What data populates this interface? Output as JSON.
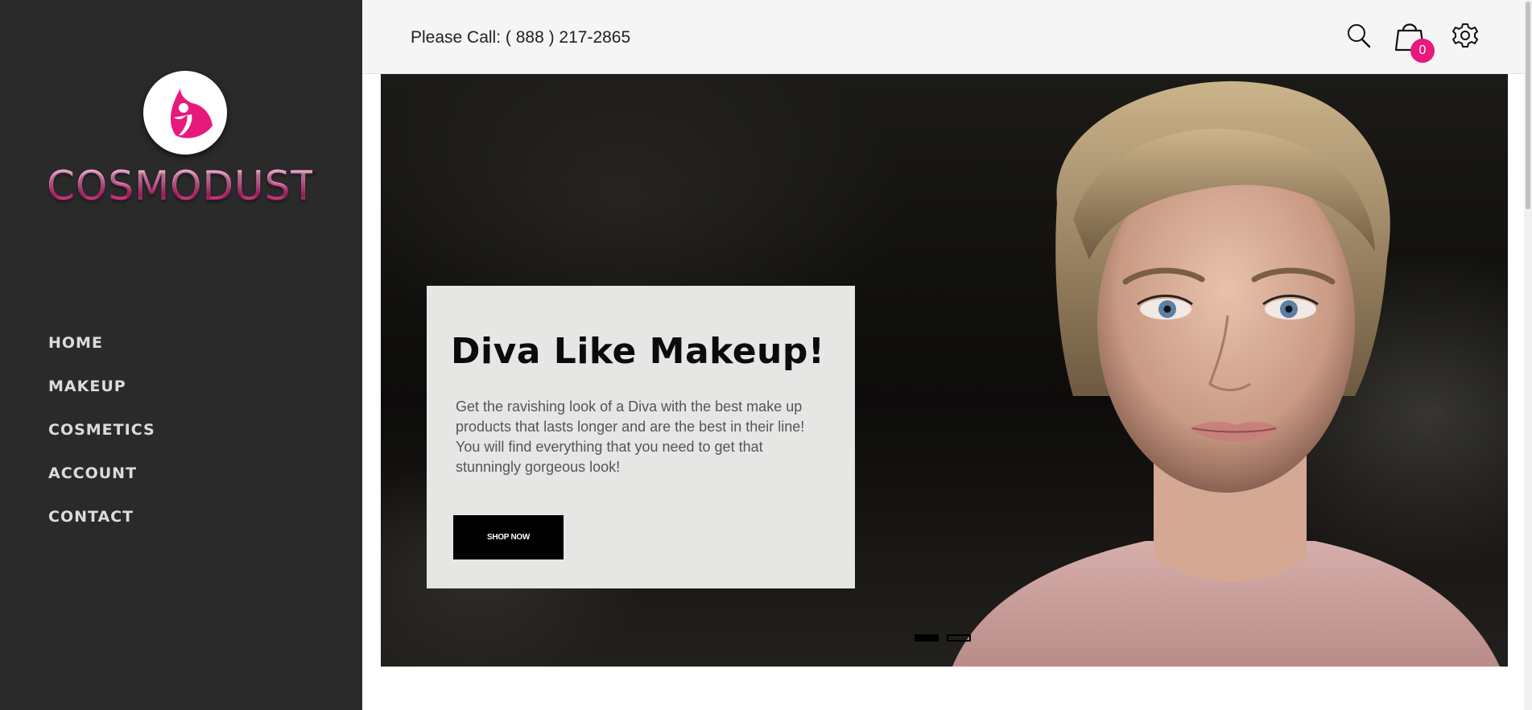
{
  "sidebar": {
    "brand_name": "COSMODUST",
    "nav_items": [
      {
        "label": "HOME"
      },
      {
        "label": "MAKEUP"
      },
      {
        "label": "COSMETICS"
      },
      {
        "label": "ACCOUNT"
      },
      {
        "label": "CONTACT"
      }
    ]
  },
  "header": {
    "phone_text": "Please Call: ( 888 ) 217-2865",
    "cart_count": "0",
    "icons": [
      "search-icon",
      "shopping-bag-icon",
      "gear-icon"
    ]
  },
  "hero": {
    "title": "Diva Like Makeup!",
    "description": "Get the ravishing look of a Diva with the best make up products that lasts longer and are the best in their line! You will find everything that you need to get that stunningly gorgeous look!",
    "button_label": "SHOP NOW",
    "slide_indicators": 2,
    "active_slide": 1
  },
  "colors": {
    "sidebar_bg": "#2a2a2b",
    "accent_pink": "#e8197d",
    "header_bg": "#f5f5f5",
    "caption_bg": "#e6e6e5"
  }
}
